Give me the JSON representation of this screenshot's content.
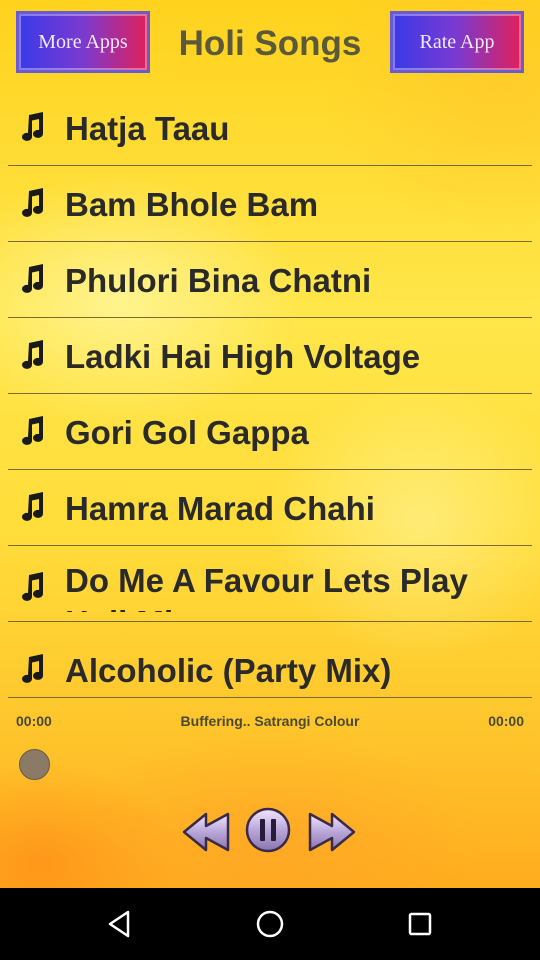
{
  "header": {
    "more_apps_label": "More Apps",
    "title": "Holi Songs",
    "rate_app_label": "Rate App"
  },
  "songs": [
    {
      "label": "Hatja Taau"
    },
    {
      "label": "Bam Bhole Bam"
    },
    {
      "label": "Phulori Bina Chatni"
    },
    {
      "label": "Ladki Hai High Voltage"
    },
    {
      "label": "Gori Gol Gappa"
    },
    {
      "label": "Hamra Marad Chahi"
    },
    {
      "label": "Do Me A Favour Lets Play Holi Mix"
    },
    {
      "label": "Alcoholic (Party Mix)"
    }
  ],
  "player": {
    "elapsed": "00:00",
    "status": "Buffering.. Satrangi Colour",
    "duration": "00:00",
    "progress": 0
  },
  "icons": {
    "song": "music-note-icon",
    "rewind": "rewind-icon",
    "pause": "pause-icon",
    "forward": "fast-forward-icon",
    "back": "nav-back-icon",
    "home": "nav-home-icon",
    "recents": "nav-recents-icon"
  },
  "colors": {
    "background": "#ffd21e",
    "button_gradient_start": "#3a3ae8",
    "button_gradient_end": "#e0205a",
    "text": "#2a2a2a"
  }
}
